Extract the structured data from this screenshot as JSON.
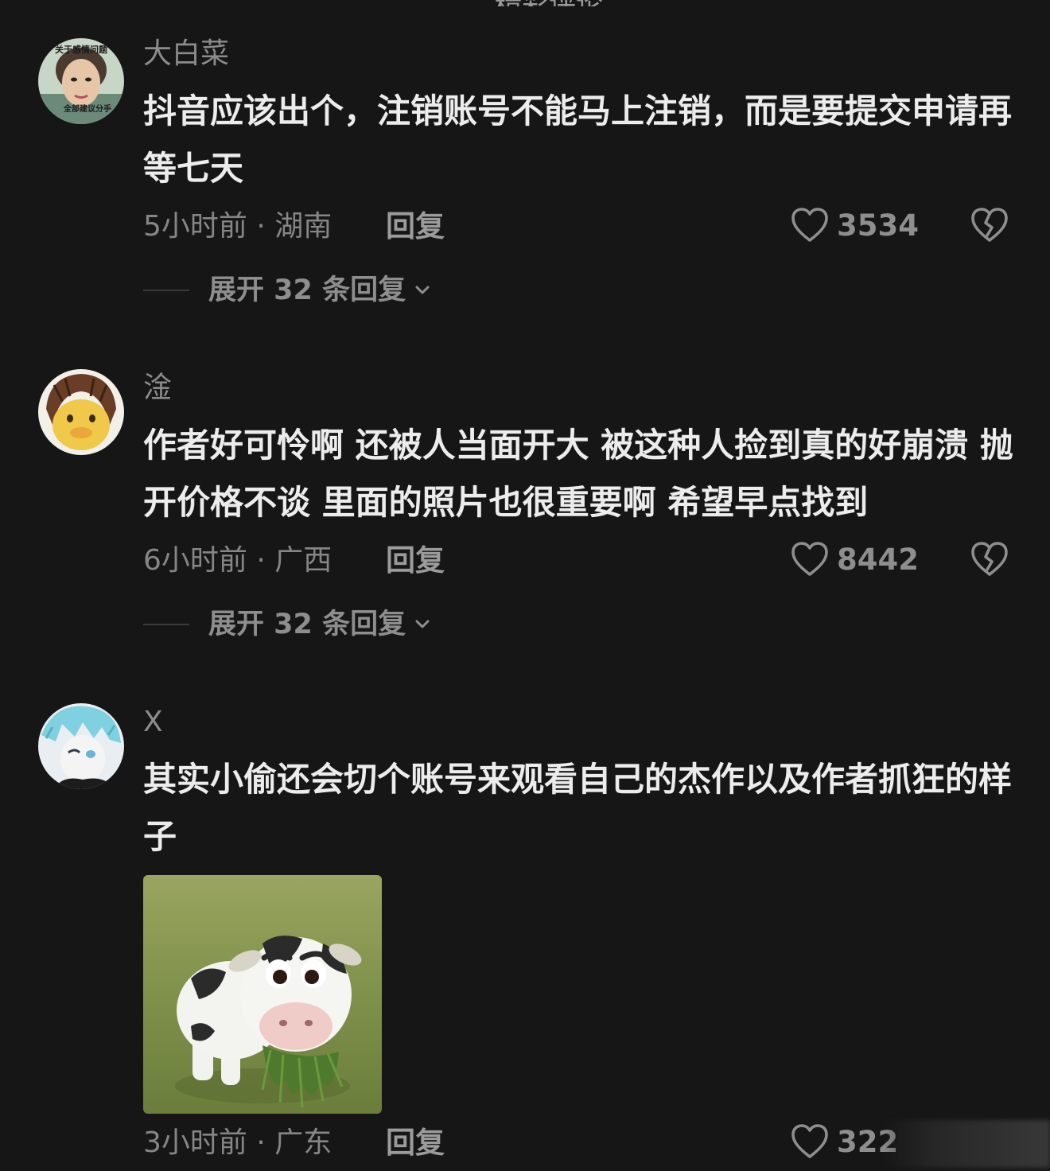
{
  "header_peek": "精彩评论",
  "comments": [
    {
      "username": "大白菜",
      "avatar": "avatar-woman",
      "avatar_caption_top": "关于感情问题",
      "avatar_caption_bottom": "全部建议分手",
      "text": "抖音应该出个，注销账号不能马上注销，而是要提交申请再等七天",
      "time": "5小时前",
      "location": "湖南",
      "reply_label": "回复",
      "likes": "3534",
      "expand_label": "展开 32 条回复"
    },
    {
      "username": "淦",
      "avatar": "avatar-duck-wig",
      "text": "作者好可怜啊 还被人当面开大 被这种人捡到真的好崩溃 抛开价格不谈 里面的照片也很重要啊 希望早点找到",
      "time": "6小时前",
      "location": "广西",
      "reply_label": "回复",
      "likes": "8442",
      "expand_label": "展开 32 条回复"
    },
    {
      "username": "X",
      "avatar": "avatar-anime-boy",
      "text": "其实小偷还会切个账号来观看自己的杰作以及作者抓狂的样子",
      "sticker": "cow-eating-grass",
      "time": "3小时前",
      "location": "广东",
      "reply_label": "回复",
      "likes": "322"
    }
  ],
  "icons": {
    "like": "heart-outline-icon",
    "dislike": "broken-heart-icon",
    "expand": "chevron-down-icon"
  },
  "colors": {
    "background": "#161616",
    "text_primary": "#ececec",
    "text_secondary": "#8c8c8c"
  }
}
